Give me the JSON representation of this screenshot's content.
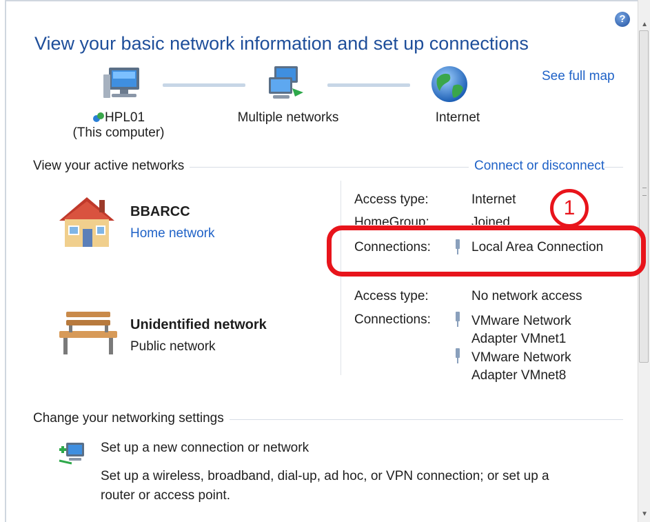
{
  "title": "View your basic network information and set up connections",
  "see_full_map": "See full map",
  "help_icon": "?",
  "map": {
    "computer_name": "HPL01",
    "computer_sub": "(This computer)",
    "middle_label": "Multiple networks",
    "internet_label": "Internet"
  },
  "active": {
    "header": "View your active networks",
    "connect_link": "Connect or disconnect"
  },
  "networks": [
    {
      "name": "BBARCC",
      "type": "Home network",
      "access_label": "Access type:",
      "access_value": "Internet",
      "homegroup_label": "HomeGroup:",
      "homegroup_value": "Joined",
      "connections_label": "Connections:",
      "connection": "Local Area Connection"
    },
    {
      "name": "Unidentified network",
      "type": "Public network",
      "access_label": "Access type:",
      "access_value": "No network access",
      "connections_label": "Connections:",
      "connection1_line1": "VMware Network",
      "connection1_line2": "Adapter VMnet1",
      "connection2_line1": "VMware Network",
      "connection2_line2": "Adapter VMnet8"
    }
  ],
  "annotation_number": "1",
  "change": {
    "header": "Change your networking settings",
    "setup_link": "Set up a new connection or network",
    "setup_desc_line1": "Set up a wireless, broadband, dial-up, ad hoc, or VPN connection; or set up a",
    "setup_desc_line2": "router or access point."
  },
  "colors": {
    "link": "#1f62c7",
    "title": "#1e4e9a",
    "annotation": "#e8141b"
  }
}
